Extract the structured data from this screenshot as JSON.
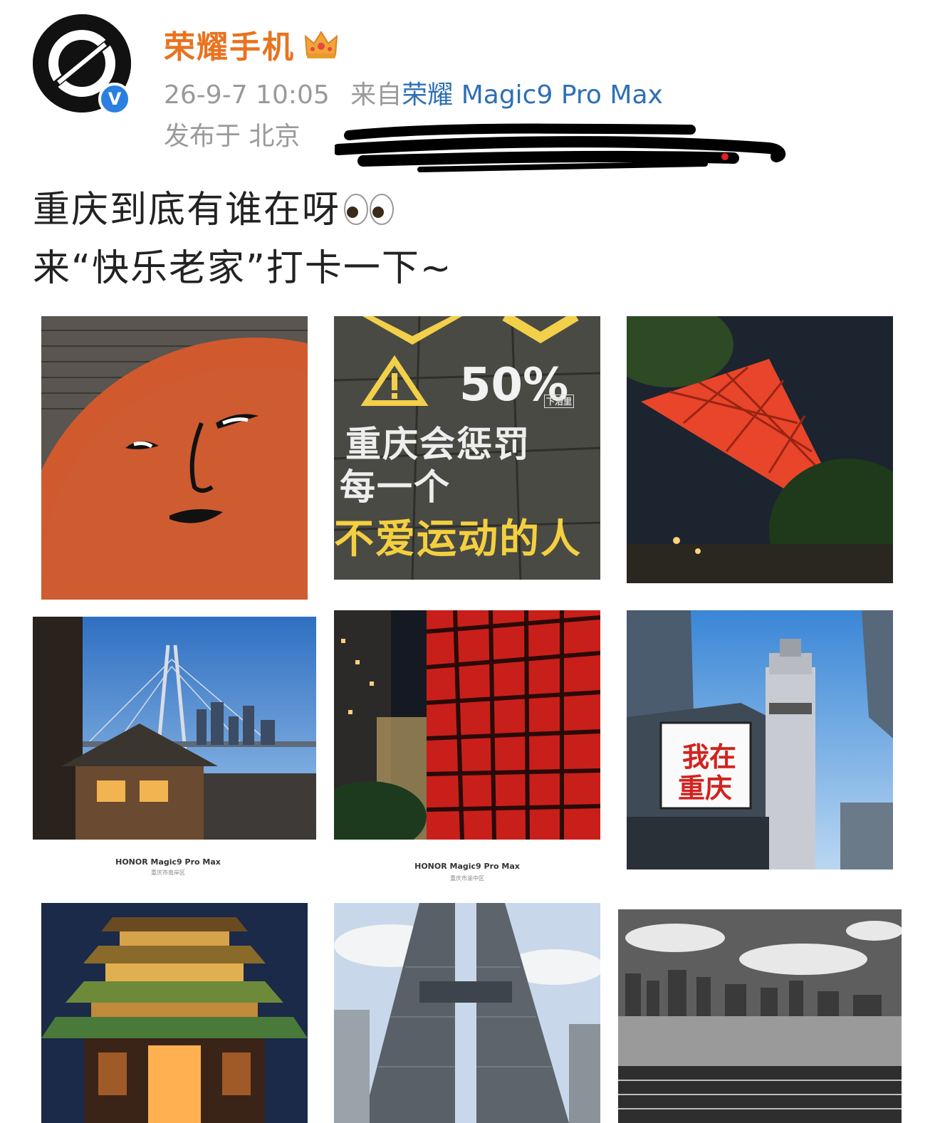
{
  "account": {
    "name": "荣耀手机",
    "verified_mark": "V",
    "avatar_icon": "honor-logo-icon",
    "crown_icon": "crown-icon"
  },
  "meta": {
    "datetime": "26-9-7 10:05",
    "via_prefix": "来自",
    "device": "荣耀 Magic9 Pro Max",
    "location": "发布于 北京"
  },
  "post": {
    "line1": "重庆到底有谁在呀",
    "line2": "来“快乐老家”打卡一下~",
    "emoji": "eyes-icon"
  },
  "photos": {
    "road_sign": {
      "percent": "50%",
      "small_tag": "下沿里",
      "line1": "重庆会惩罚",
      "line2": "每一个",
      "line3": "不爱运动的人"
    },
    "billboard": {
      "line1": "我在",
      "line2": "重庆"
    },
    "caption_bridge": "HONOR Magic9 Pro Max",
    "subcaption_bridge": "重庆市南岸区",
    "caption_red": "HONOR Magic9 Pro Max",
    "subcaption_red": "重庆市渝中区"
  },
  "colors": {
    "username": "#e8731f",
    "device_link": "#2e6fb5",
    "meta_gray": "#9a9a9a",
    "verified_blue": "#2a7fe0"
  }
}
